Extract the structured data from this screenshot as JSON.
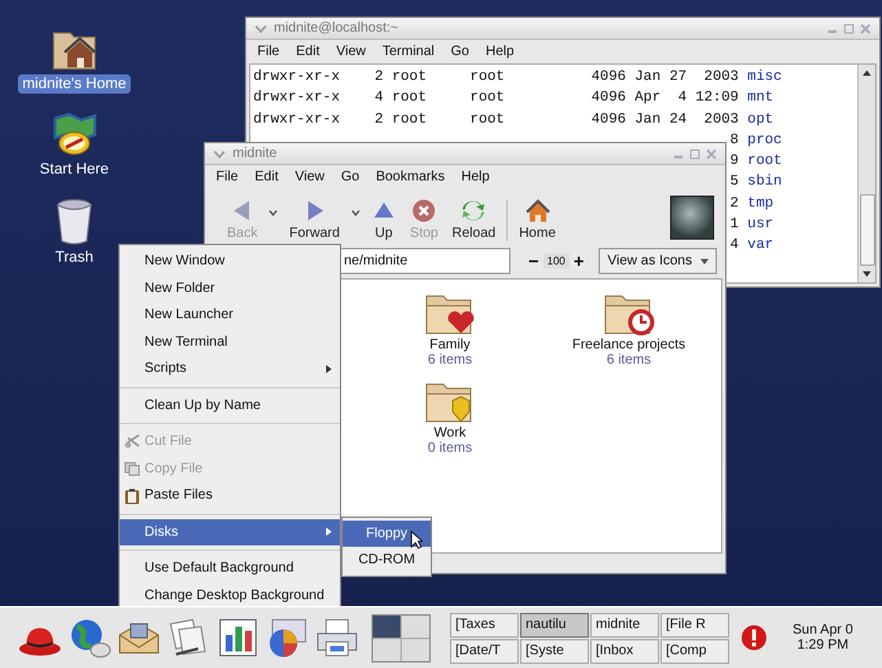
{
  "desktop_icons": [
    {
      "kind": "home",
      "label": "midnite's Home",
      "selected": true
    },
    {
      "kind": "start",
      "label": "Start Here",
      "selected": false
    },
    {
      "kind": "trash",
      "label": "Trash",
      "selected": false
    }
  ],
  "terminal": {
    "title": "midnite@localhost:~",
    "menu": [
      "File",
      "Edit",
      "View",
      "Terminal",
      "Go",
      "Help"
    ],
    "lines": [
      {
        "text": "drwxr-xr-x    2 root     root          4096 Jan 27  2003",
        "name": "misc"
      },
      {
        "text": "drwxr-xr-x    4 root     root          4096 Apr  4 12:09",
        "name": "mnt"
      },
      {
        "text": "drwxr-xr-x    2 root     root          4096 Jan 24  2003",
        "name": "opt"
      },
      {
        "text": "8",
        "name": "proc"
      },
      {
        "text": "9",
        "name": "root"
      },
      {
        "text": "5",
        "name": "sbin"
      },
      {
        "text": "2",
        "name": "tmp"
      },
      {
        "text": "1",
        "name": "usr"
      },
      {
        "text": "4",
        "name": "var"
      }
    ]
  },
  "file_manager": {
    "title": "midnite",
    "menu": [
      "File",
      "Edit",
      "View",
      "Go",
      "Bookmarks",
      "Help"
    ],
    "toolbar": [
      {
        "kind": "back",
        "label": "Back",
        "disabled": true
      },
      {
        "kind": "forward",
        "label": "Forward",
        "disabled": false
      },
      {
        "kind": "up",
        "label": "Up",
        "disabled": false
      },
      {
        "kind": "stop",
        "label": "Stop",
        "disabled": true
      },
      {
        "kind": "reload",
        "label": "Reload",
        "disabled": false
      },
      {
        "kind": "home",
        "label": "Home",
        "disabled": false
      }
    ],
    "location": "ne/midnite",
    "zoom_out": "−",
    "zoom": "100",
    "zoom_in": "+",
    "view_mode": "View as Icons",
    "folders": [
      {
        "kind": "heart",
        "name": "Family",
        "count": "6 items"
      },
      {
        "kind": "clock",
        "name": "Freelance projects",
        "count": "6 items"
      },
      {
        "kind": "badge",
        "name": "Work",
        "count": "0 items"
      }
    ]
  },
  "context_menu": {
    "sections": [
      [
        {
          "kind": "plain",
          "label": "New Window",
          "disabled": false,
          "selected": false
        },
        {
          "kind": "plain",
          "label": "New Folder",
          "disabled": false,
          "selected": false
        },
        {
          "kind": "plain",
          "label": "New Launcher",
          "disabled": false,
          "selected": false
        },
        {
          "kind": "plain",
          "label": "New Terminal",
          "disabled": false,
          "selected": false
        },
        {
          "kind": "submenu",
          "label": "Scripts",
          "disabled": false,
          "selected": false
        }
      ],
      [
        {
          "kind": "plain",
          "label": "Clean Up by Name",
          "disabled": false,
          "selected": false
        }
      ],
      [
        {
          "kind": "cut",
          "label": "Cut File",
          "disabled": true,
          "selected": false
        },
        {
          "kind": "copy",
          "label": "Copy File",
          "disabled": true,
          "selected": false
        },
        {
          "kind": "paste",
          "label": "Paste Files",
          "disabled": false,
          "selected": false
        }
      ],
      [
        {
          "kind": "submenu",
          "label": "Disks",
          "disabled": false,
          "selected": true
        }
      ],
      [
        {
          "kind": "plain",
          "label": "Use Default Background",
          "disabled": false,
          "selected": false
        },
        {
          "kind": "plain",
          "label": "Change Desktop Background",
          "disabled": false,
          "selected": false
        }
      ]
    ]
  },
  "submenu": {
    "items": [
      {
        "label": "Floppy",
        "selected": true
      },
      {
        "label": "CD-ROM",
        "selected": false
      }
    ]
  },
  "panel": {
    "tasks": [
      {
        "label": "[Taxes",
        "selected": false
      },
      {
        "label": "nautilu",
        "selected": true
      },
      {
        "label": "midnite",
        "selected": false
      },
      {
        "label": "[File R",
        "selected": false
      },
      {
        "label": "[Date/T",
        "selected": false
      },
      {
        "label": "[Syste",
        "selected": false
      },
      {
        "label": "[Inbox",
        "selected": false
      },
      {
        "label": "[Comp",
        "selected": false
      }
    ],
    "clock": {
      "date": "Sun Apr 0",
      "time": "1:29 PM"
    }
  }
}
